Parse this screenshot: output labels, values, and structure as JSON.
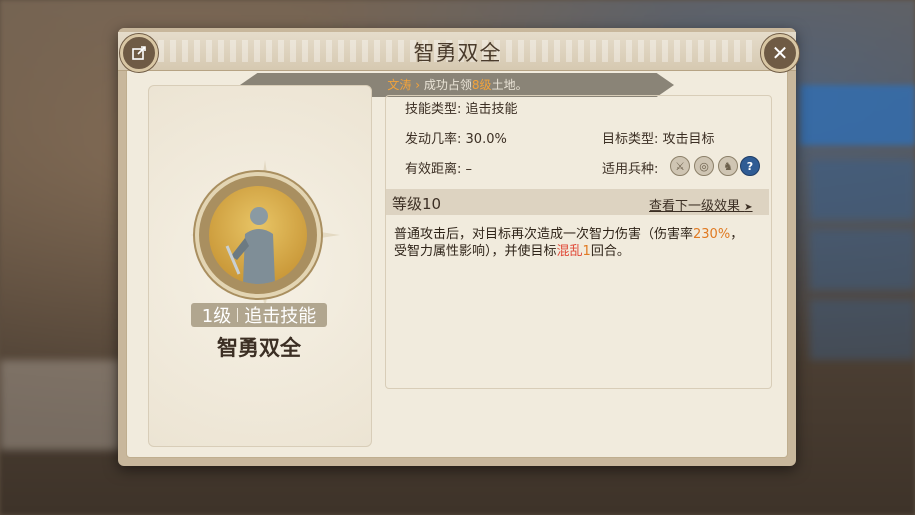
{
  "dialog": {
    "title": "智勇双全",
    "share_icon": "share-icon",
    "close_icon": "close-icon"
  },
  "acquire": {
    "hero": "文涛",
    "arrow": "›",
    "text_before": "成功占领",
    "level_highlight": "8级",
    "text_after": "土地。"
  },
  "skill_card": {
    "level": "1级",
    "type": "追击技能",
    "name": "智勇双全"
  },
  "stats": {
    "skill_type_label": "技能类型:",
    "skill_type_value": "追击技能",
    "trigger_rate_label": "发动几率:",
    "trigger_rate_value": "30.0%",
    "target_type_label": "目标类型:",
    "target_type_value": "攻击目标",
    "range_label": "有效距离:",
    "range_value": "–",
    "unit_label": "适用兵种:",
    "unit_icons": [
      "sword-unit-icon",
      "bow-unit-icon",
      "cavalry-unit-icon",
      "help-icon"
    ],
    "help_glyph": "?"
  },
  "level_section": {
    "label": "等级10",
    "next_link": "查看下一级效果",
    "next_arrow": "➤"
  },
  "description": {
    "part1": "普通攻击后，对目标再次造成一次智力伤害（伤害率",
    "rate": "230%",
    "part2": "，受智力属性影响），并使目标",
    "status": "混乱",
    "rounds": "1",
    "part3": "回合。"
  },
  "colors": {
    "accent_orange": "#e07a22",
    "highlight_red": "#e04b3a",
    "hero_gold": "#f3a33a"
  }
}
